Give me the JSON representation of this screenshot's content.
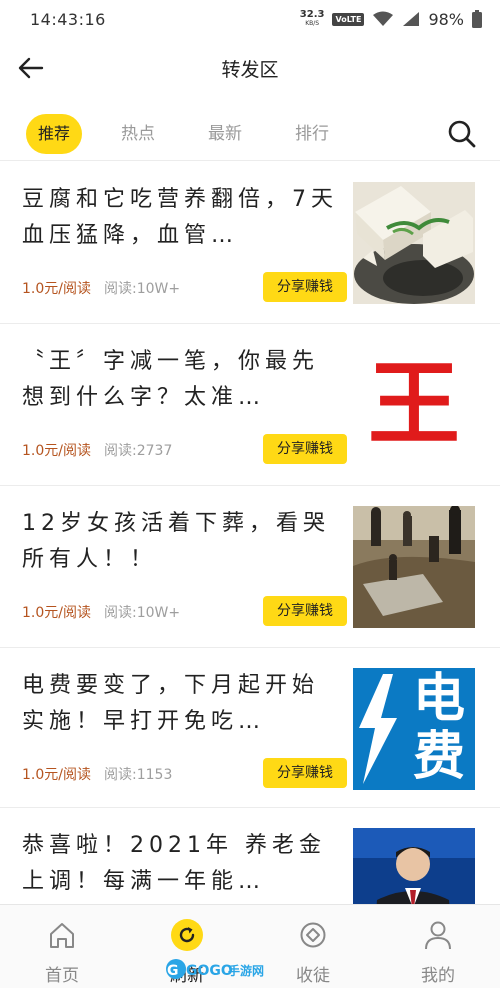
{
  "status_bar": {
    "time": "14:43:16",
    "net_speed": "32.3",
    "net_unit": "KB/S",
    "volte": "VoLTE",
    "battery": "98%"
  },
  "header": {
    "title": "转发区"
  },
  "tabs": [
    {
      "label": "推荐",
      "active": true
    },
    {
      "label": "热点",
      "active": false
    },
    {
      "label": "最新",
      "active": false
    },
    {
      "label": "排行",
      "active": false
    }
  ],
  "articles": [
    {
      "title": "豆腐和它吃营养翻倍，7天血压猛降，血管…",
      "price": "1.0元/阅读",
      "reads": "阅读:10W+",
      "share": "分享赚钱",
      "thumb_icon": "tofu-dish-photo"
    },
    {
      "title": "〝王〞字减一笔，你最先想到什么字？太准…",
      "price": "1.0元/阅读",
      "reads": "阅读:2737",
      "share": "分享赚钱",
      "thumb_icon": "wang-character-image",
      "thumb_text": "王"
    },
    {
      "title": "12岁女孩活着下葬，看哭所有人！！",
      "price": "1.0元/阅读",
      "reads": "阅读:10W+",
      "share": "分享赚钱",
      "thumb_icon": "burial-scene-photo"
    },
    {
      "title": "电费要变了，下月起开始实施！早打开免吃…",
      "price": "1.0元/阅读",
      "reads": "阅读:1153",
      "share": "分享赚钱",
      "thumb_icon": "electricity-fee-image",
      "thumb_text_1": "电",
      "thumb_text_2": "费"
    },
    {
      "title": "恭喜啦！2021年 养老金上调！每满一年能…",
      "price": "",
      "reads": "",
      "share": "",
      "thumb_icon": "news-anchor-photo"
    }
  ],
  "bottom_nav": [
    {
      "label": "首页",
      "icon": "home-icon",
      "active": false
    },
    {
      "label": "刷新",
      "icon": "refresh-icon",
      "active": true
    },
    {
      "label": "收徒",
      "icon": "apprentice-icon",
      "active": false
    },
    {
      "label": "我的",
      "icon": "profile-icon",
      "active": false
    }
  ],
  "watermark": "GOGO手游网",
  "colors": {
    "accent": "#ffd915",
    "price": "#b5541f",
    "muted": "#9e9e9e"
  }
}
